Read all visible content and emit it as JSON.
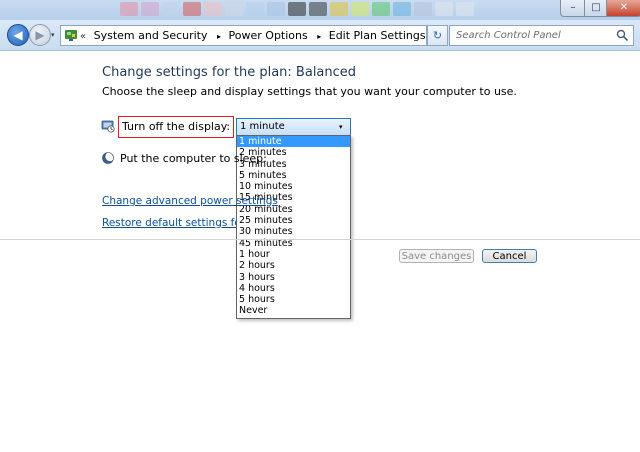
{
  "colors": {
    "accent": "#3399ff",
    "link": "#0b4f9b",
    "title_text": "#1e395b",
    "highlight_border": "#e02020"
  },
  "titlebar": {
    "minimize_symbol": "–",
    "maximize_symbol": "□",
    "close_symbol": "✕"
  },
  "nav": {
    "back_symbol": "◀",
    "forward_symbol": "▶",
    "dropdown_symbol": "▾",
    "refresh_symbol": "↻",
    "breadcrumb_overflow": "«",
    "breadcrumb_separator": "▸",
    "breadcrumbs": [
      "System and Security",
      "Power Options",
      "Edit Plan Settings"
    ],
    "search_placeholder": "Search Control Panel",
    "icons": {
      "back": "back-arrow-icon",
      "forward": "forward-arrow-icon",
      "control_panel": "control-panel-icon",
      "refresh": "refresh-icon",
      "search": "search-icon"
    }
  },
  "main": {
    "title": "Change settings for the plan: Balanced",
    "subtitle": "Choose the sleep and display settings that you want your computer to use.",
    "display_setting": {
      "label": "Turn off the display:",
      "icon": "display-timer-icon",
      "selected": "1 minute",
      "dropdown_symbol": "▾",
      "options": [
        "1 minute",
        "2 minutes",
        "3 minutes",
        "5 minutes",
        "10 minutes",
        "15 minutes",
        "20 minutes",
        "25 minutes",
        "30 minutes",
        "45 minutes",
        "1 hour",
        "2 hours",
        "3 hours",
        "4 hours",
        "5 hours",
        "Never"
      ]
    },
    "sleep_setting": {
      "label": "Put the computer to sleep:",
      "icon": "moon-sleep-icon"
    },
    "links": {
      "advanced": "Change advanced power settings",
      "restore": "Restore default settings for this plan"
    },
    "buttons": {
      "save": "Save changes",
      "cancel": "Cancel"
    }
  }
}
